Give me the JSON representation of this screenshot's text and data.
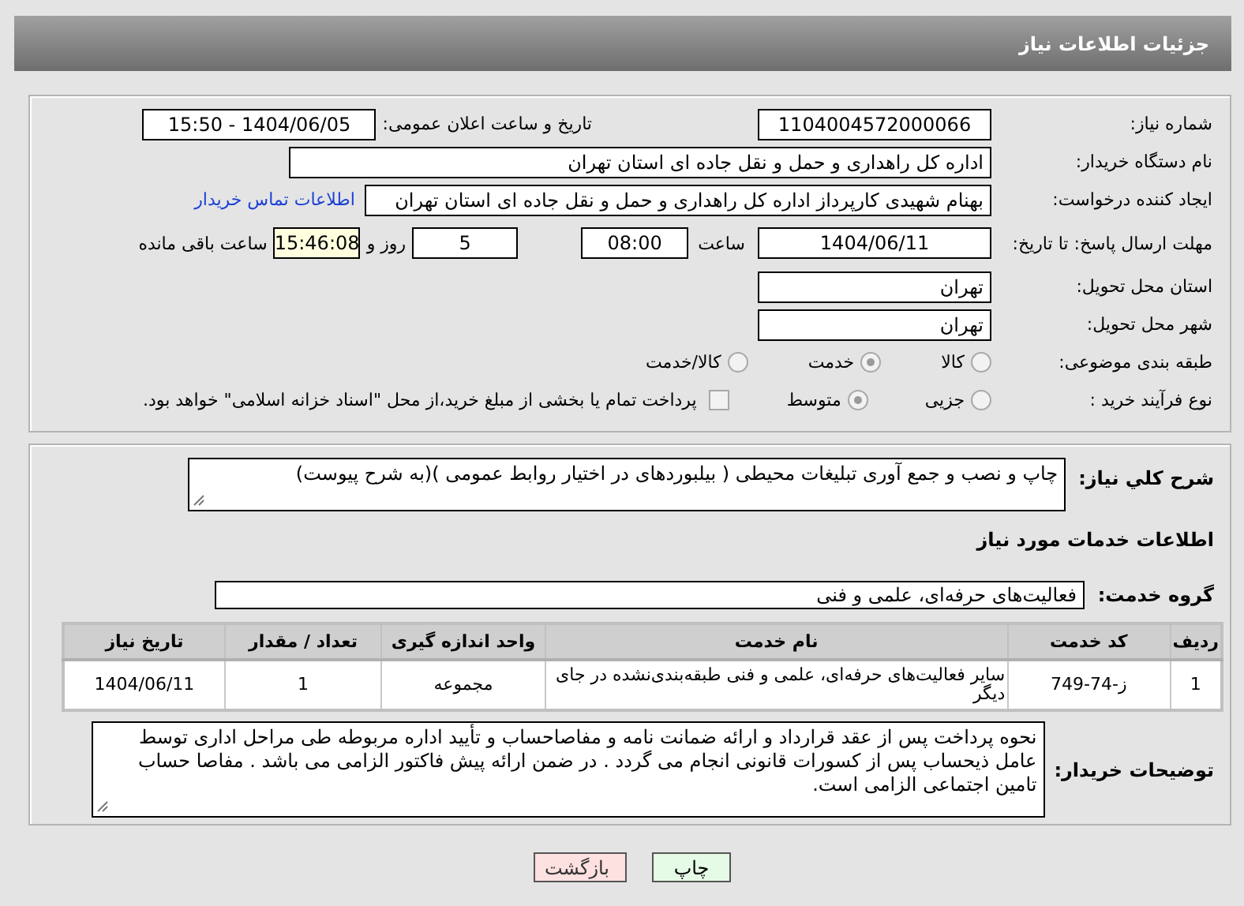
{
  "header": {
    "title": "جزئیات اطلاعات نیاز"
  },
  "details": {
    "need_number": {
      "label": "شماره نیاز:",
      "value": "1104004572000066"
    },
    "announce_datetime": {
      "label": "تاریخ و ساعت اعلان عمومی:",
      "value": "1404/06/05 - 15:50"
    },
    "buyer_org": {
      "label": "نام دستگاه خریدار:",
      "value": "اداره کل راهداری و حمل و نقل جاده ای استان تهران"
    },
    "requester": {
      "label": "ایجاد کننده درخواست:",
      "value": "بهنام شهیدی کارپرداز اداره کل راهداری و حمل و نقل جاده ای استان تهران",
      "link": "اطلاعات تماس خریدار"
    },
    "deadline": {
      "label": "مهلت ارسال پاسخ: تا تاریخ:",
      "date": "1404/06/11",
      "time_label": "ساعت",
      "time": "08:00",
      "days": "5",
      "days_label": "روز و",
      "remaining": "15:46:08",
      "remaining_label": "ساعت باقی مانده"
    },
    "province": {
      "label": "استان محل تحویل:",
      "value": "تهران"
    },
    "city": {
      "label": "شهر محل تحویل:",
      "value": "تهران"
    },
    "category": {
      "label": "طبقه بندی موضوعی:",
      "options": [
        {
          "label": "کالا",
          "selected": false
        },
        {
          "label": "خدمت",
          "selected": true
        },
        {
          "label": "کالا/خدمت",
          "selected": false
        }
      ]
    },
    "process": {
      "label": "نوع فرآیند خرید :",
      "options": [
        {
          "label": "جزیی",
          "selected": false
        },
        {
          "label": "متوسط",
          "selected": true
        }
      ],
      "treasury": {
        "label": "پرداخت تمام یا بخشی از مبلغ خرید،از محل \"اسناد خزانه اسلامی\" خواهد بود.",
        "checked": false
      }
    }
  },
  "need": {
    "summary": {
      "label": "شرح کلي نياز:",
      "value": "چاپ و نصب و جمع آوری تبلیغات محیطی ( بیلبوردهای در اختیار روابط عمومی )(به شرح پیوست)"
    },
    "services_title": "اطلاعات خدمات مورد نیاز",
    "service_group": {
      "label": "گروه خدمت:",
      "value": "فعالیت‌های حرفه‌ای، علمی و فنی"
    },
    "table": {
      "columns": [
        "ردیف",
        "کد خدمت",
        "نام خدمت",
        "واحد اندازه گیری",
        "تعداد / مقدار",
        "تاریخ نیاز"
      ],
      "rows": [
        [
          "1",
          "ز-74-749",
          "سایر فعالیت‌های حرفه‌ای، علمی و فنی طبقه‌بندی‌نشده در جای دیگر",
          "مجموعه",
          "1",
          "1404/06/11"
        ]
      ]
    },
    "buyer_notes": {
      "label": "توضیحات خریدار:",
      "value": "نحوه پرداخت پس از عقد قرارداد و ارائه ضمانت نامه و مفاصاحساب و تأیید اداره مربوطه طی مراحل اداری توسط عامل ذیحساب پس از کسورات قانونی انجام می گردد . در ضمن ارائه پیش فاکتور الزامی می باشد . مفاصا حساب تامین اجتماعی الزامی است."
    }
  },
  "buttons": [
    {
      "label": "چاپ",
      "kind": "print"
    },
    {
      "label": "بازگشت",
      "kind": "back"
    }
  ]
}
